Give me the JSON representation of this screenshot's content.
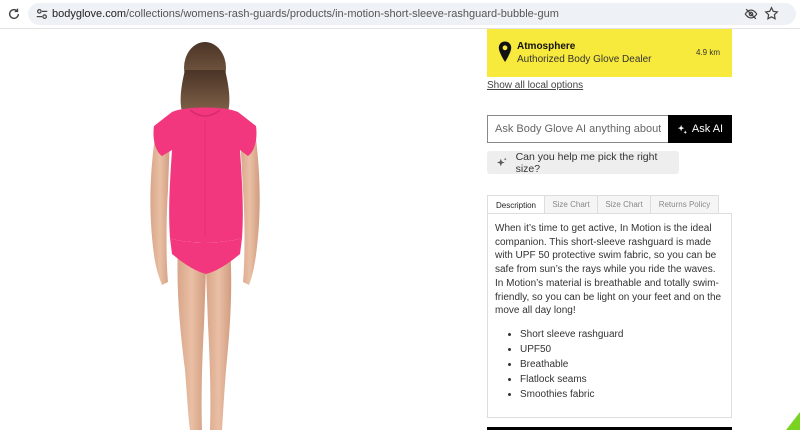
{
  "browser": {
    "url_domain": "bodyglove.com",
    "url_path": "/collections/womens-rash-guards/products/in-motion-short-sleeve-rashguard-bubble-gum",
    "icons": [
      "reload-icon",
      "site-info-icon",
      "eye-off-icon",
      "star-icon"
    ]
  },
  "product": {
    "image_alt": "In Motion Short Sleeve Rashguard - Bubble Gum",
    "shirt_color": "#f2377e"
  },
  "dealer": {
    "name": "Atmosphere",
    "subtitle": "Authorized Body Glove Dealer",
    "distance": "4.9 km",
    "background": "#f7ea3c"
  },
  "links": {
    "show_local": "Show all local options"
  },
  "ai": {
    "placeholder": "Ask Body Glove AI anything about t...",
    "button_label": "Ask AI",
    "suggestion": "Can you help me pick the right size?"
  },
  "tabs": [
    "Description",
    "Size Chart",
    "Size Chart",
    "Returns Policy"
  ],
  "description": {
    "text": "When it’s time to get active, In Motion is the ideal companion. This short-sleeve rashguard is made with UPF 50 protective swim fabric, so you can be safe from sun’s the rays while you ride the waves. In Motion’s material is breathable and totally swim-friendly, so you can be light on your feet and on the move all day long!",
    "features": [
      "Short sleeve rashguard",
      "UPF50",
      "Breathable",
      "Flatlock seams",
      "Smoothies fabric"
    ]
  }
}
